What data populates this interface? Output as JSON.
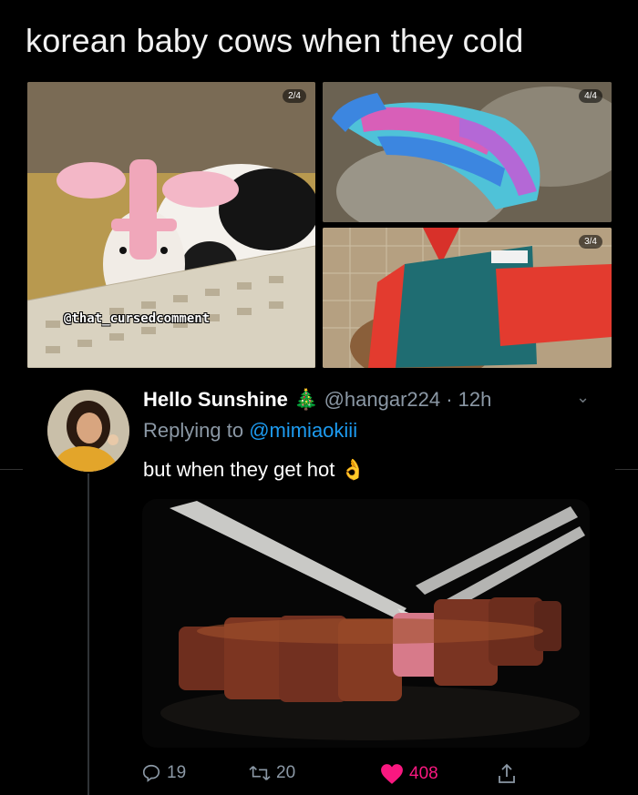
{
  "meme": {
    "title": "korean baby cows when they cold",
    "watermark": "@that_cursedcomment",
    "photos": [
      {
        "counter": "2/4"
      },
      {
        "counter": "4/4"
      },
      {
        "counter": "3/4"
      }
    ]
  },
  "tweet": {
    "display_name": "Hello Sunshine",
    "emoji": "🎄",
    "handle_time": "@hangar224 · 12h",
    "replying_label": "Replying to ",
    "replying_to": "@mimiaokiii",
    "text": "but when they get hot",
    "text_emoji": "👌"
  },
  "actions": {
    "reply_count": "19",
    "retweet_count": "20",
    "like_count": "408"
  },
  "colors": {
    "background": "#000000",
    "link": "#1d9bf0",
    "muted": "#8b98a5",
    "like": "#f91880"
  }
}
